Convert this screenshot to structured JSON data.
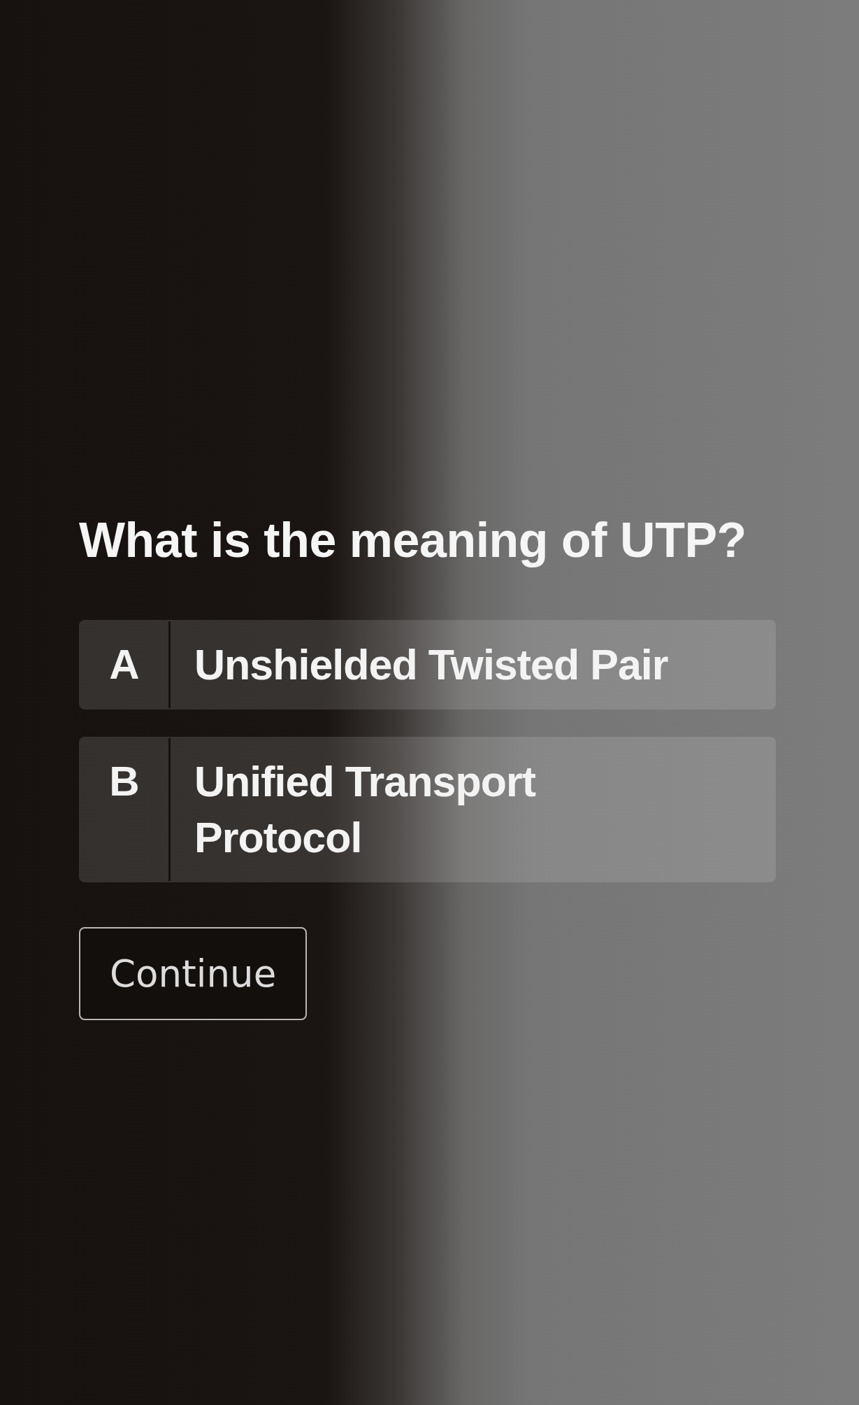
{
  "question": "What is the meaning of UTP?",
  "options": [
    {
      "letter": "A",
      "text": "Unshielded Twisted Pair",
      "selected": false
    },
    {
      "letter": "B",
      "text": "Unified Transport Protocol",
      "selected": false
    }
  ],
  "continue_button": {
    "label": "Continue"
  }
}
